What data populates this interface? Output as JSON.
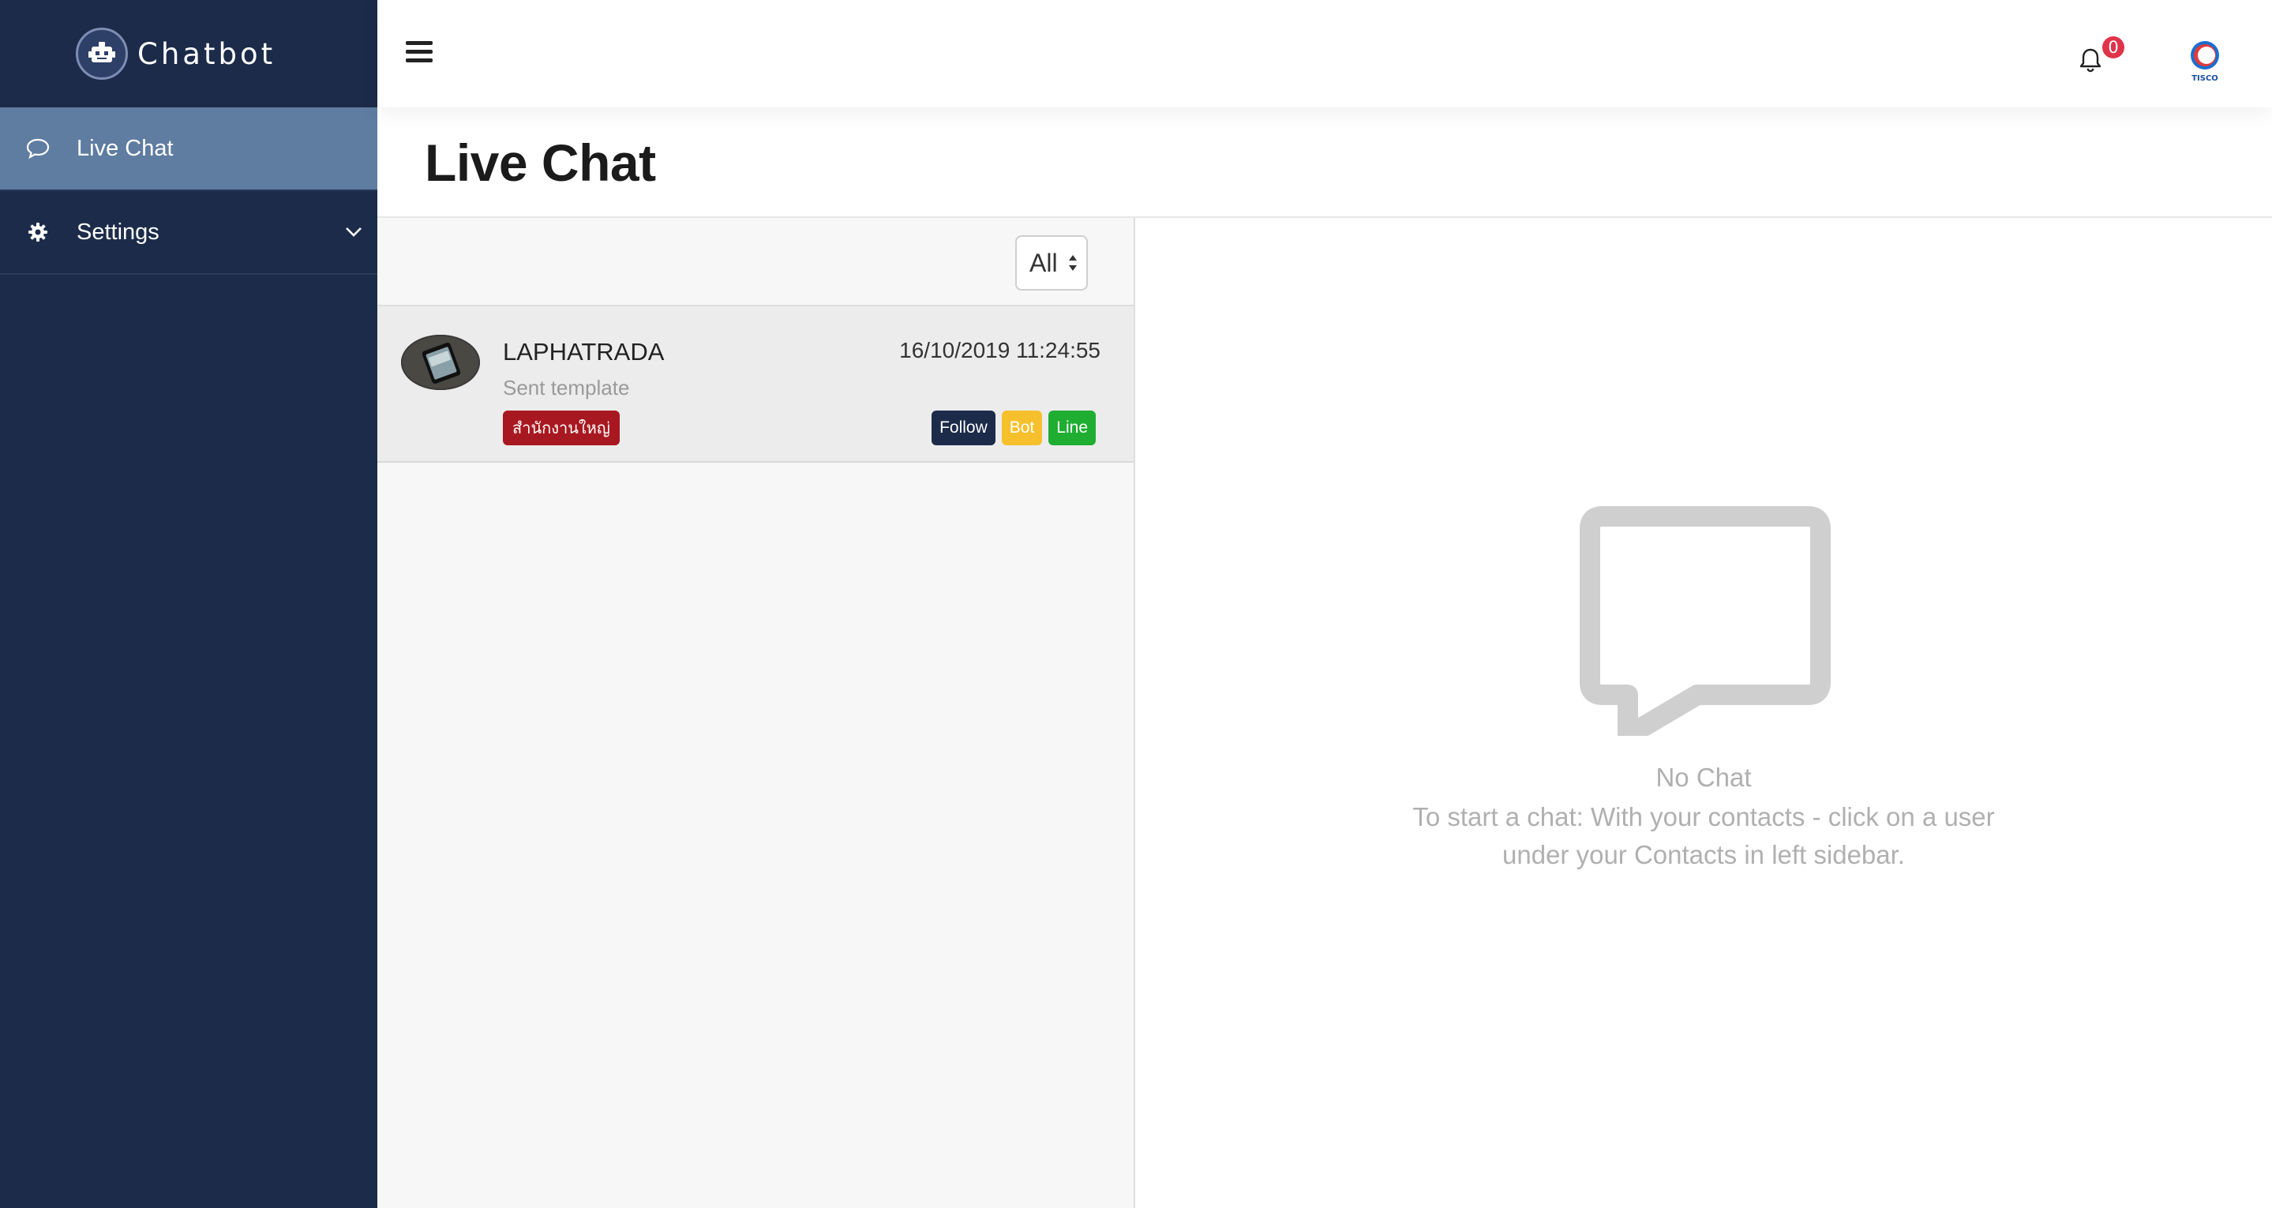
{
  "brand": {
    "name": "Chatbot",
    "logo_icon": "robot-icon"
  },
  "sidebar": {
    "items": [
      {
        "label": "Live Chat",
        "icon": "chat-bubble-icon",
        "active": true
      },
      {
        "label": "Settings",
        "icon": "gear-icon",
        "expandable": true
      }
    ]
  },
  "topbar": {
    "menu_icon": "hamburger-icon",
    "notification_count": "0",
    "notification_icon": "bell-icon",
    "logo_text": "TISCO"
  },
  "page": {
    "title": "Live Chat"
  },
  "filter": {
    "selected": "All"
  },
  "chats": [
    {
      "name": "LAPHATRADA",
      "timestamp": "16/10/2019 11:24:55",
      "preview": "Sent template",
      "department": "สำนักงานใหญ่",
      "tags": [
        "Follow",
        "Bot",
        "Line"
      ]
    }
  ],
  "empty_state": {
    "title": "No Chat",
    "message": "To start a chat: With your contacts - click on a user under your Contacts in left sidebar."
  },
  "colors": {
    "sidebar_bg": "#1c2b49",
    "sidebar_active": "#5f7ca1",
    "department_badge": "#a81820",
    "tag_follow": "#1c2b49",
    "tag_bot": "#f6c02d",
    "tag_line": "#1fae32",
    "notification_badge": "#e0334a"
  }
}
